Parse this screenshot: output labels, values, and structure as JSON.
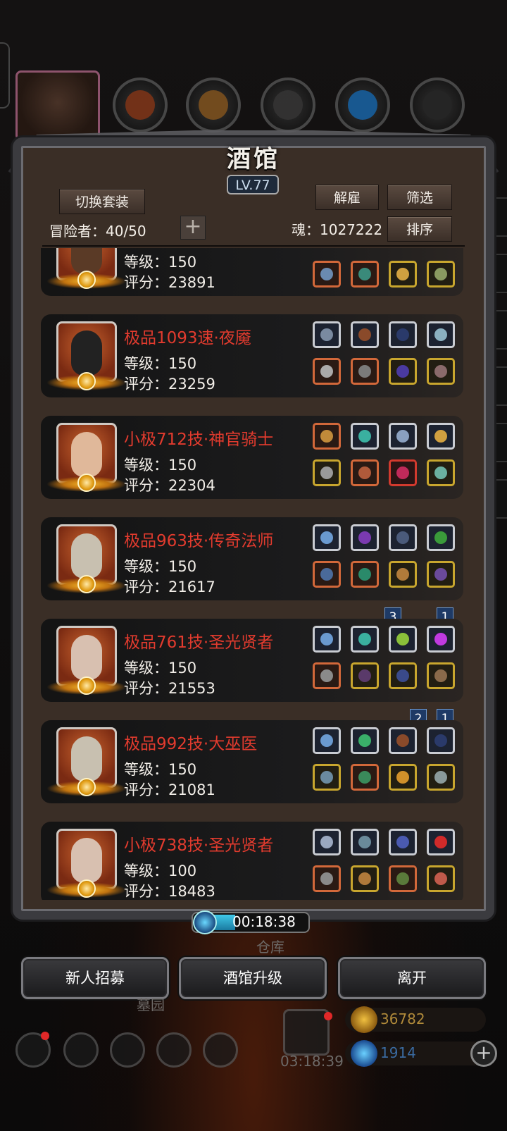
{
  "title": "酒馆",
  "level": "LV.77",
  "buttons": {
    "switch_set": "切换套装",
    "dismiss": "解雇",
    "filter": "筛选",
    "sort": "排序",
    "add": "+"
  },
  "adventurers_label": "冒险者：40/50",
  "soul_label": "魂：1027222",
  "heroes": [
    {
      "name": "",
      "level": "等级：150",
      "score": "评分：23891"
    },
    {
      "name": "极品1093速·夜魇",
      "level": "等级：150",
      "score": "评分：23259"
    },
    {
      "name": "小极712技·神官骑士",
      "level": "等级：150",
      "score": "评分：22304"
    },
    {
      "name": "极品963技·传奇法师",
      "level": "等级：150",
      "score": "评分：21617"
    },
    {
      "name": "极品761技·圣光贤者",
      "level": "等级：150",
      "score": "评分：21553"
    },
    {
      "name": "极品992技·大巫医",
      "level": "等级：150",
      "score": "评分：21081"
    },
    {
      "name": "小极738技·圣光贤者",
      "level": "等级：100",
      "score": "评分：18483"
    }
  ],
  "tags": {
    "row5_left": "3",
    "row5_right": "1",
    "row6_left": "2",
    "row6_right": "1"
  },
  "timer": "00:18:38",
  "warehouse": "仓库",
  "bottom_buttons": {
    "recruit": "新人招募",
    "upgrade": "酒馆升级",
    "leave": "离开"
  },
  "background": {
    "garden": "墓园",
    "gift_timer": "03:18:39",
    "gold": "36782",
    "gems": "1914"
  },
  "colors": {
    "hero_name": "#e23b2e",
    "panel": "#3a2e26",
    "frame": "#3b3b3f"
  }
}
